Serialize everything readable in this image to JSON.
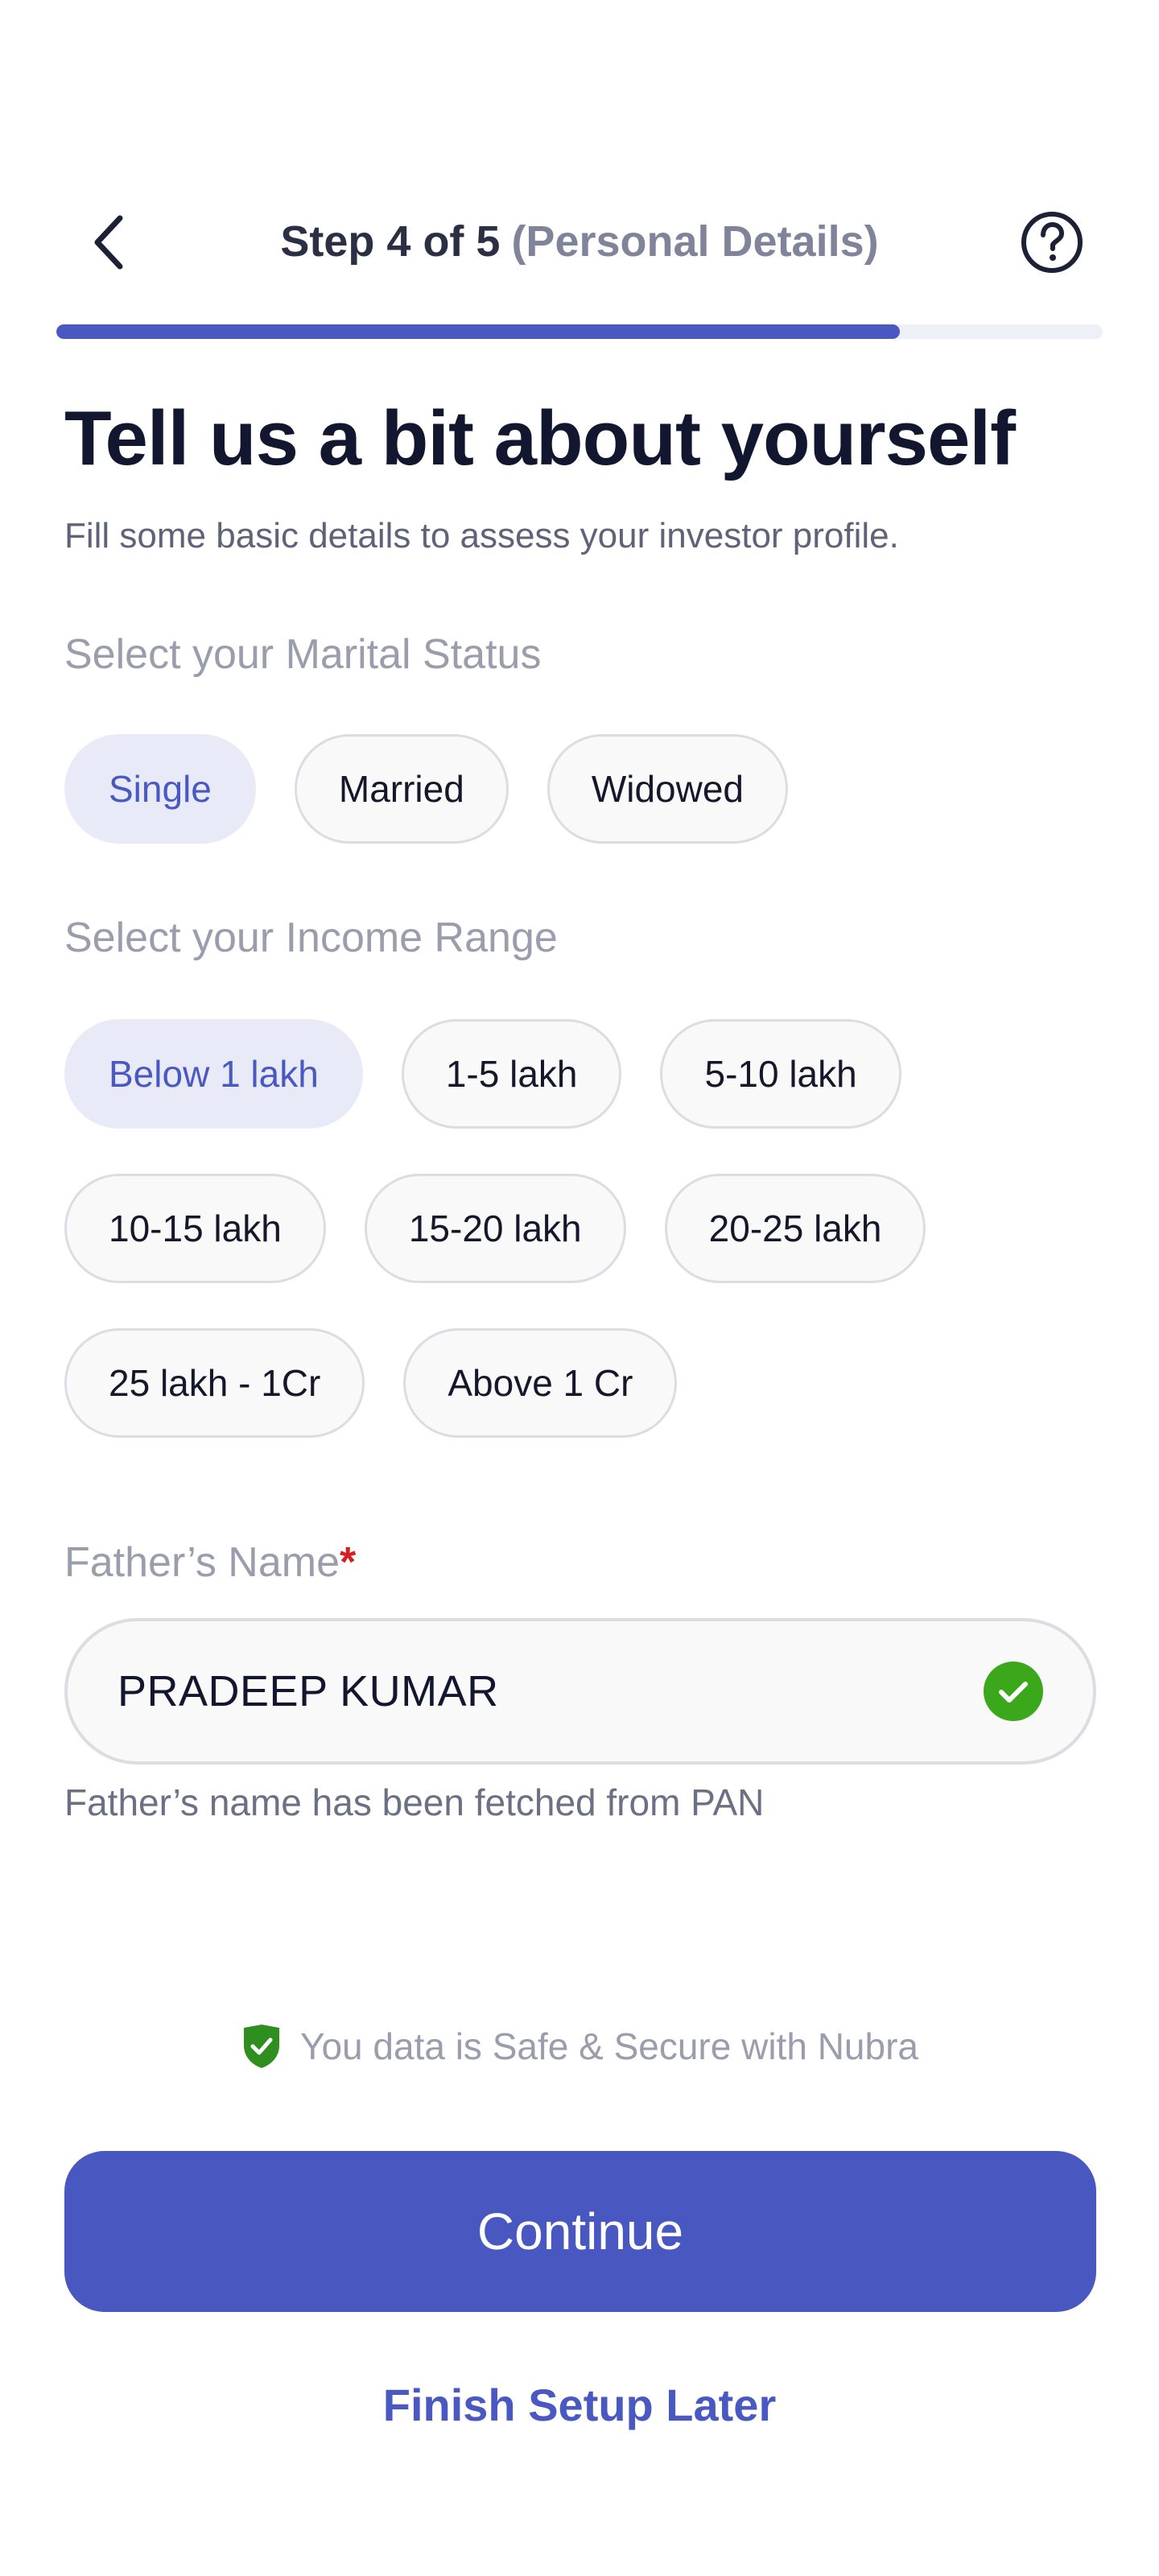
{
  "header": {
    "step_text": "Step 4 of 5",
    "step_subtitle": "(Personal Details)",
    "back_icon": "chevron-left-icon",
    "help_icon": "question-circle-icon"
  },
  "progress": {
    "fraction": 0.806,
    "fill_color": "#4a58c2",
    "track_color": "#eef0f7"
  },
  "main": {
    "title": "Tell us a bit about yourself",
    "subtitle": "Fill some basic details to assess your investor profile."
  },
  "marital_status": {
    "label": "Select your Marital Status",
    "options": [
      "Single",
      "Married",
      "Widowed"
    ],
    "selected": "Single"
  },
  "income_range": {
    "label": "Select your Income Range",
    "options": [
      "Below 1 lakh",
      "1-5 lakh",
      "5-10 lakh",
      "10-15 lakh",
      "15-20 lakh",
      "20-25 lakh",
      "25 lakh - 1Cr",
      "Above 1 Cr"
    ],
    "selected": "Below 1 lakh"
  },
  "fathers_name": {
    "label": "Father’s Name",
    "required_mark": "*",
    "value": "PRADEEP KUMAR",
    "verified_icon": "check-circle-icon",
    "helper": "Father’s name has been fetched from PAN"
  },
  "security": {
    "icon": "shield-check-icon",
    "text": "You data is Safe & Secure with Nubra"
  },
  "actions": {
    "continue_label": "Continue",
    "later_label": "Finish Setup Later"
  },
  "colors": {
    "accent": "#4a58c2",
    "success": "#3aa81a",
    "selected_chip_bg": "#e8eaf7"
  }
}
